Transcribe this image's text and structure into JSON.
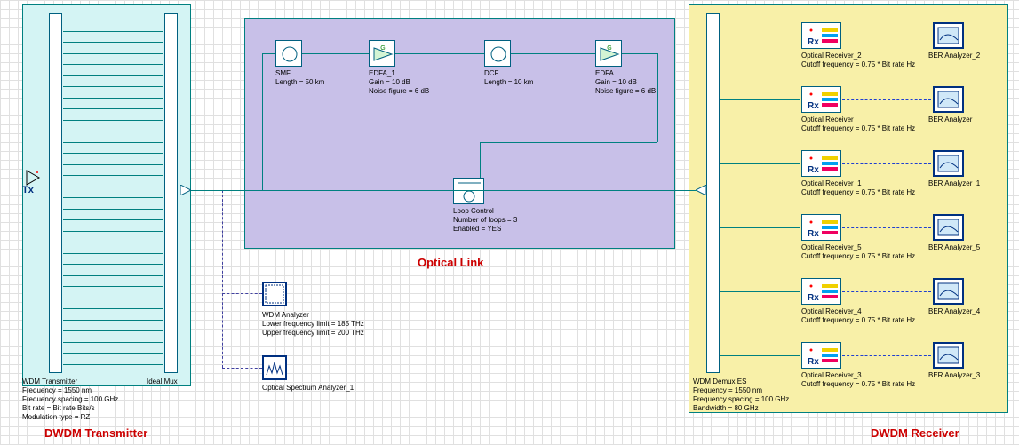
{
  "transmitter": {
    "title": "DWDM Transmitter",
    "wdm_tx_labels": [
      "WDM Transmitter",
      "Frequency = 1550  nm",
      "Frequency spacing = 100  GHz",
      "Bit rate = Bit rate  Bits/s",
      "Modulation type = RZ"
    ],
    "mux_label": "Ideal Mux",
    "tx_symbol": "Tx"
  },
  "link": {
    "title": "Optical Link",
    "smf": [
      "SMF",
      "Length = 50  km"
    ],
    "edfa1": [
      "EDFA_1",
      "Gain = 10  dB",
      "Noise figure = 6  dB"
    ],
    "dcf": [
      "DCF",
      "Length = 10  km"
    ],
    "edfa2": [
      "EDFA",
      "Gain = 10  dB",
      "Noise figure = 6  dB"
    ],
    "loop": [
      "Loop Control",
      "Number of loops = 3",
      "Enabled = YES"
    ]
  },
  "analyzers": {
    "wdm": [
      "WDM Analyzer",
      "Lower frequency limit = 185  THz",
      "Upper frequency limit = 200  THz"
    ],
    "osa": "Optical Spectrum Analyzer_1"
  },
  "receiver": {
    "title": "DWDM Receiver",
    "demux": [
      "WDM Demux ES",
      "Frequency = 1550  nm",
      "Frequency spacing = 100  GHz",
      "Bandwidth = 80  GHz"
    ],
    "rx_symbol": "Rx",
    "rows": [
      {
        "rx": "Optical Receiver_2",
        "cutoff": "Cutoff frequency = 0.75 * Bit rate  Hz",
        "ber": "BER Analyzer_2"
      },
      {
        "rx": "Optical Receiver",
        "cutoff": "Cutoff frequency = 0.75 * Bit rate  Hz",
        "ber": "BER Analyzer"
      },
      {
        "rx": "Optical Receiver_1",
        "cutoff": "Cutoff frequency = 0.75 * Bit rate  Hz",
        "ber": "BER Analyzer_1"
      },
      {
        "rx": "Optical Receiver_5",
        "cutoff": "Cutoff frequency = 0.75 * Bit rate  Hz",
        "ber": "BER Analyzer_5"
      },
      {
        "rx": "Optical Receiver_4",
        "cutoff": "Cutoff frequency = 0.75 * Bit rate  Hz",
        "ber": "BER Analyzer_4"
      },
      {
        "rx": "Optical Receiver_3",
        "cutoff": "Cutoff frequency = 0.75 * Bit rate  Hz",
        "ber": "BER Analyzer_3"
      }
    ]
  }
}
